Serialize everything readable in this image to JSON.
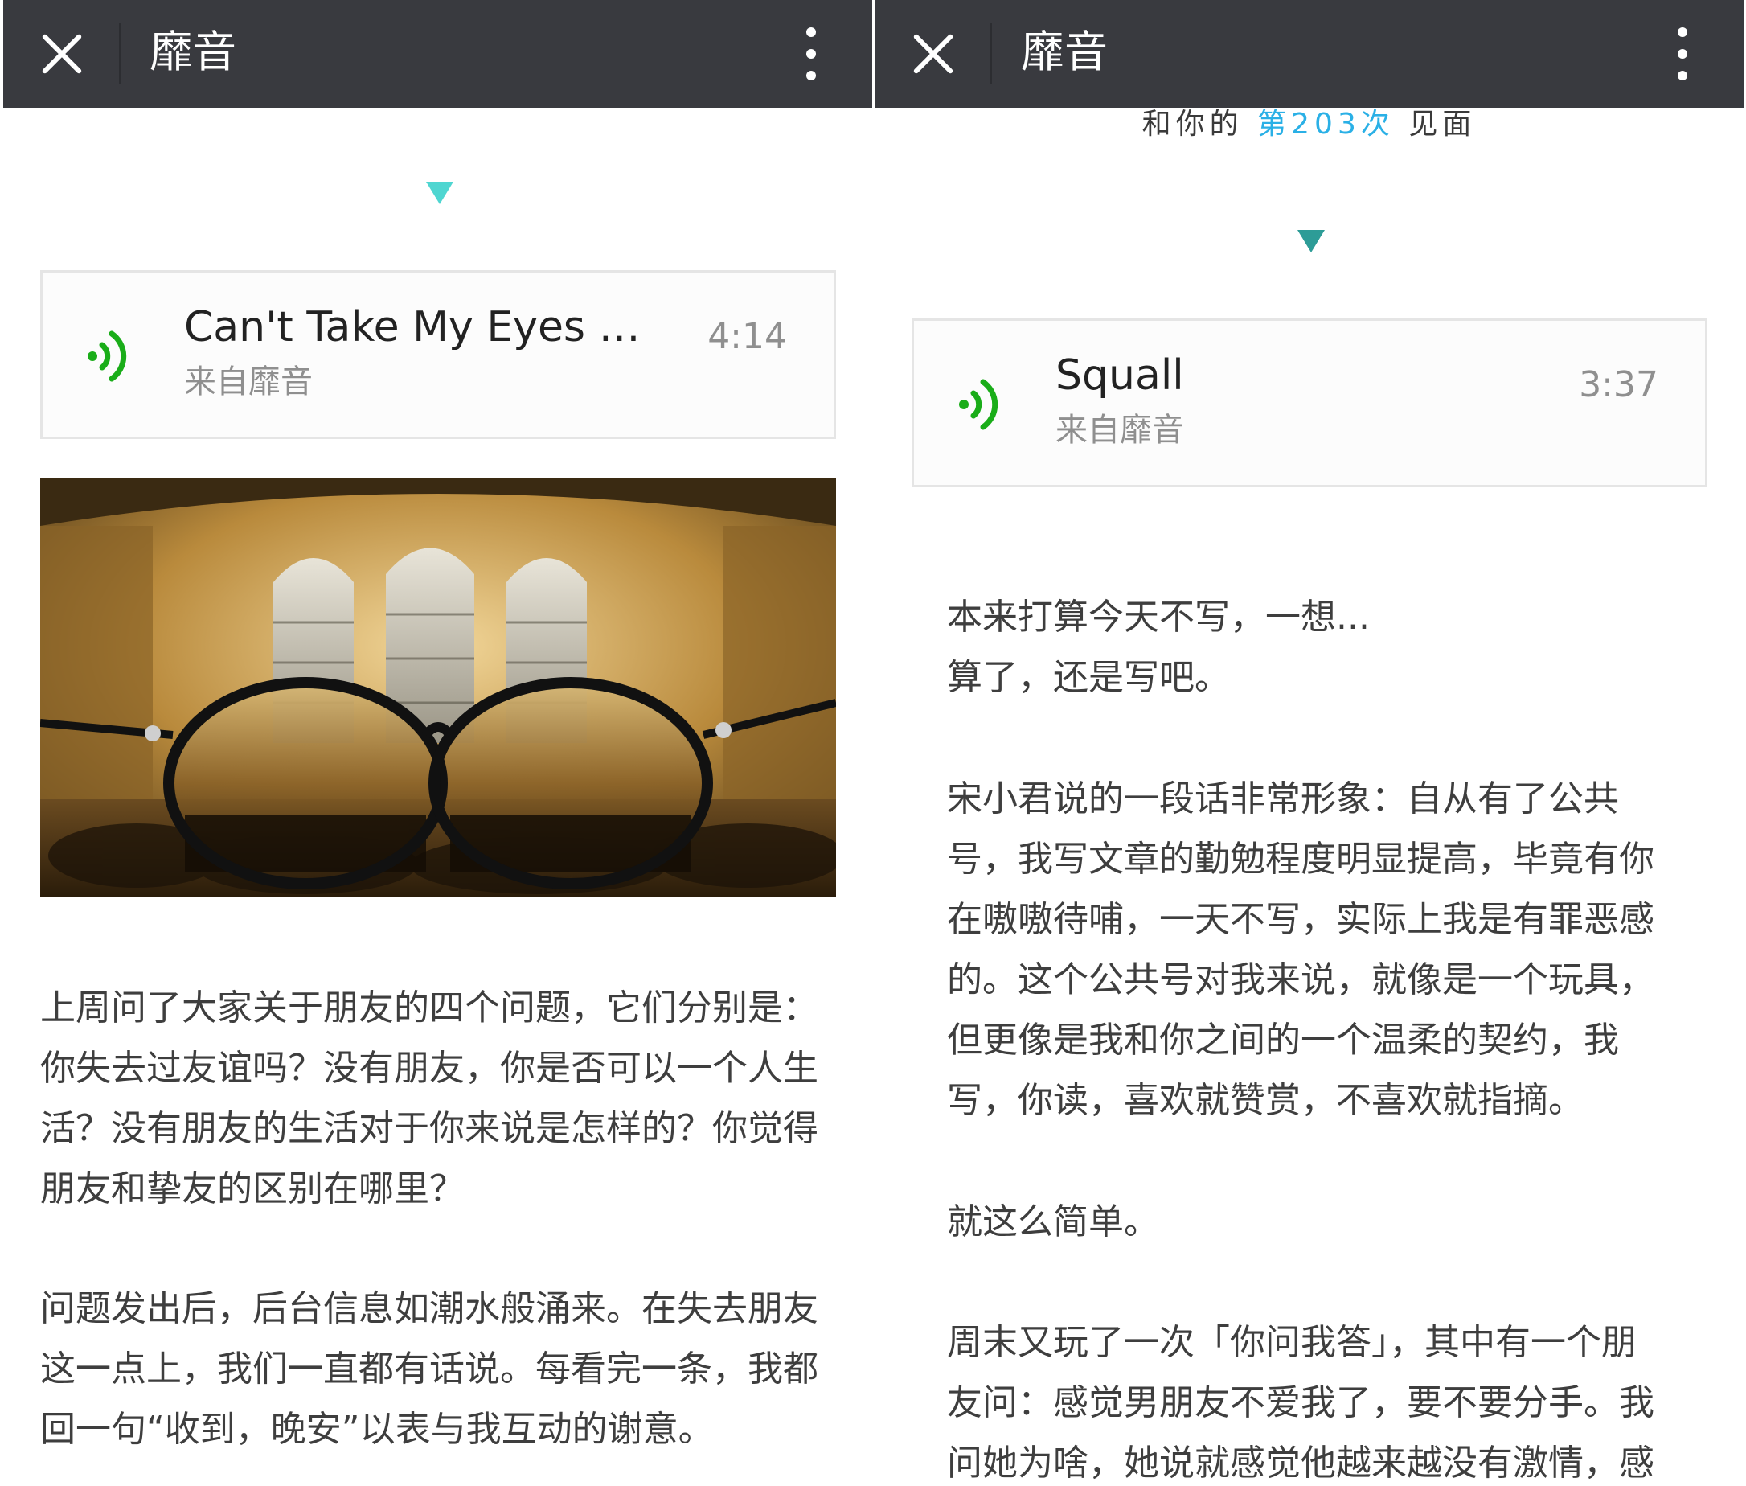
{
  "app": {
    "title": "靡音"
  },
  "left": {
    "song": {
      "title": "Can't Take My Eyes Of…",
      "source": "来自靡音",
      "duration": "4:14"
    },
    "paragraphs": [
      {
        "lines": [
          "上周问了大家关于朋友的四个问题，它们分别是：",
          "你失去过友谊吗？没有朋友，你是否可以一个人生",
          "活？没有朋友的生活对于你来说是怎样的？你觉得",
          "朋友和挚友的区别在哪里？"
        ]
      },
      {
        "lines": [
          "问题发出后，后台信息如潮水般涌来。在失去朋友",
          "这一点上，我们一直都有话说。每看完一条，我都",
          "回一句“收到，晚安”以表与我互动的谢意。"
        ]
      }
    ]
  },
  "right": {
    "meet": {
      "prefix": "和你的",
      "highlight": "第203次",
      "suffix": "见面"
    },
    "song": {
      "title": "Squall",
      "source": "来自靡音",
      "duration": "3:37"
    },
    "paragraphs": [
      {
        "lines": [
          "本来打算今天不写，一想...",
          "算了，还是写吧。"
        ]
      },
      {
        "lines": [
          "宋小君说的一段话非常形象：自从有了公共",
          "号，我写文章的勤勉程度明显提高，毕竟有你",
          "在嗷嗷待哺，一天不写，实际上我是有罪恶感",
          "的。这个公共号对我来说，就像是一个玩具，",
          "但更像是我和你之间的一个温柔的契约，我",
          "写，你读，喜欢就赞赏，不喜欢就指摘。"
        ]
      },
      {
        "lines": [
          "就这么简单。"
        ]
      },
      {
        "lines": [
          "周末又玩了一次「你问我答」，其中有一个朋",
          "友问：感觉男朋友不爱我了，要不要分手。我",
          "问她为啥，她说就感觉他越来越没有激情，感"
        ]
      }
    ]
  },
  "colors": {
    "topbar": "#393a3f",
    "accent_teal": "#4fd6d1",
    "wave_green": "#1aad19",
    "link_blue": "#2ab0e6"
  }
}
